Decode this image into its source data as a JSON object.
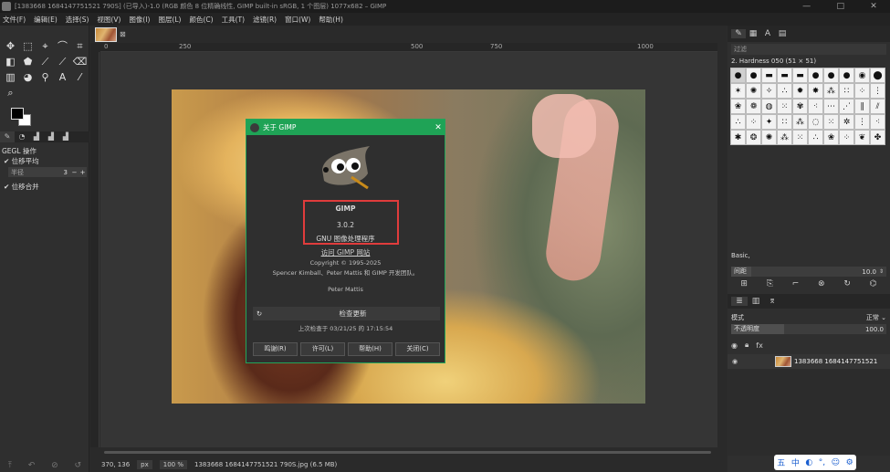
{
  "window": {
    "title": "[1383668 1684147751521 790S] (已导入)-1.0 (RGB 颜色 8 位精确线性, GIMP built-in sRGB, 1 个图层) 1077x682 – GIMP",
    "controls": [
      "—",
      "□",
      "✕"
    ]
  },
  "menubar": [
    "文件(F)",
    "编辑(E)",
    "选择(S)",
    "视图(V)",
    "图像(I)",
    "图层(L)",
    "颜色(C)",
    "工具(T)",
    "滤镜(R)",
    "窗口(W)",
    "帮助(H)"
  ],
  "toolbox": {
    "tools": [
      "✥",
      "⬚",
      "⌖",
      "⌒",
      "⌗",
      "◧",
      "⬟",
      "⟋",
      "⟋",
      "⌫",
      "▥",
      "◕",
      "⚲",
      "A",
      "⁄",
      "⌕"
    ],
    "options_title": "GEGL 操作",
    "checkbox_1": "✔ 位移平均",
    "radius_label": "半径",
    "radius_value": "3",
    "checkbox_2": "✔ 位移合并",
    "tabs": [
      "✎",
      "◔",
      "▟",
      "▟",
      "▟"
    ]
  },
  "canvas": {
    "ruler_labels": [
      "0",
      "250",
      "500",
      "750",
      "1000"
    ]
  },
  "about_dialog": {
    "title": "关于 GIMP",
    "app_name": "GIMP",
    "version": "3.0.2",
    "subtitle": "GNU 图像处理程序",
    "visit_link": "访问 GIMP 网站",
    "copyright": "Copyright © 1995-2025",
    "authors": "Spencer Kimball、Peter Mattis 和 GIMP 开发团队。",
    "credit_name": "Peter Mattis",
    "update_button": "检查更新",
    "last_checked": "上次检查于 03/21/25 的 17:15:54",
    "buttons": [
      "鸣谢(R)",
      "许可(L)",
      "帮助(H)",
      "关闭(C)"
    ]
  },
  "right_panel": {
    "brush_filter_placeholder": "过滤",
    "brush_name": "2. Hardness 050 (51 × 51)",
    "brush_glyphs": [
      "●",
      "●",
      "▬",
      "▬",
      "▬",
      "●",
      "●",
      "●",
      "◉",
      "⬤",
      "✶",
      "✺",
      "✧",
      "∴",
      "✹",
      "✸",
      "⁂",
      "∷",
      "⁘",
      "⋮",
      "❀",
      "❁",
      "◍",
      "⁙",
      "✾",
      "⁖",
      "⋯",
      "⋰",
      "∥",
      "⫽",
      "∴",
      "⁘",
      "✦",
      "∷",
      "⁂",
      "◌",
      "⁙",
      "✲",
      "⋮",
      "⁖",
      "✱",
      "❂",
      "✺",
      "⁂",
      "⁙",
      "∴",
      "❀",
      "⁘",
      "❦",
      "✤"
    ],
    "preset": "Basic,",
    "spacing_label": "间距",
    "spacing_value": "10.0",
    "mode_label": "模式",
    "mode_value": "正常 ⌄",
    "opacity_label": "不透明度",
    "opacity_value": "100.0",
    "layer_name": "1383668 1684147751521"
  },
  "statusbar": {
    "coords": "370, 136",
    "unit": "px",
    "zoom": "100 %",
    "file_info": "1383668 1684147751521 790S.jpg (6.5 MB)"
  },
  "ime": {
    "items": [
      "五",
      "中",
      "◐",
      "°,",
      "☺",
      "⚙"
    ]
  }
}
